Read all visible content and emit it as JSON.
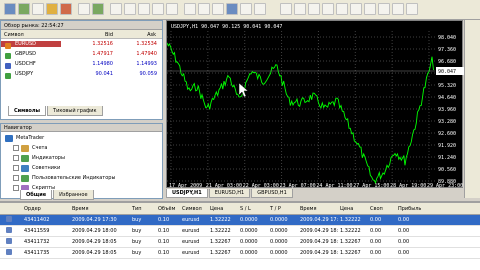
{
  "market_watch": {
    "title": "Обзор рынка: 22:54:27",
    "col_symbol": "Символ",
    "col_bid": "Bid",
    "col_ask": "Ask",
    "rows": [
      {
        "symbol": "EURUSD",
        "bid": "1.32516",
        "ask": "1.32534",
        "highlight": true
      },
      {
        "symbol": "GBPUSD",
        "bid": "1.47917",
        "ask": "1.47940",
        "highlight": false
      },
      {
        "symbol": "USDCHF",
        "bid": "1.14980",
        "ask": "1.14993",
        "highlight": false
      },
      {
        "symbol": "USDJPY",
        "bid": "90.041",
        "ask": "90.059",
        "highlight": false
      }
    ],
    "tabs": [
      "Символы",
      "Тиковый график"
    ]
  },
  "navigator": {
    "title": "Навигатор",
    "root": "MetaTrader",
    "items": [
      "Счета",
      "Индикаторы",
      "Советники",
      "Пользовательские Индикаторы",
      "Скрипты"
    ],
    "tabs": [
      "Общие",
      "Избранное"
    ]
  },
  "chart": {
    "header": "USDJPY,H1  90.047 90.125 90.041 90.047",
    "price_labels": [
      "98.040",
      "97.360",
      "96.680",
      "96.000",
      "95.320",
      "94.640",
      "93.960",
      "93.280",
      "92.600",
      "91.920",
      "91.240",
      "90.560",
      "89.880"
    ],
    "current_price": "90.047",
    "time_labels": [
      "17 Apr 2009",
      "21 Apr 03:00",
      "22 Apr 03:00",
      "23 Apr 07:00",
      "24 Apr 11:00",
      "27 Apr 15:00",
      "28 Apr 19:00",
      "29 Apr 23:00"
    ],
    "tabs": [
      "USDJPY,H1",
      "EURUSD,H1",
      "GBPUSD,H1"
    ],
    "colors": {
      "background": "#000000",
      "line": "#00ff00",
      "grid": "#404040"
    }
  },
  "terminal": {
    "headers": [
      "",
      "Ордер",
      "Время",
      "Тип",
      "Объём",
      "Символ",
      "Цена",
      "S / L",
      "T / P",
      "Время",
      "Цена",
      "Своп",
      "Прибыль"
    ],
    "rows": [
      {
        "order": "43411402",
        "time": "2009.04.29 17:30",
        "type": "buy",
        "volume": "0.10",
        "symbol": "eurusd",
        "price": "1.32222",
        "sl": "0.0000",
        "tp": "0.0000",
        "time2": "2009.04.29 17:39",
        "price2": "1.32222",
        "swap": "0.00",
        "profit": "0.00",
        "selected": true
      },
      {
        "order": "43411559",
        "time": "2009.04.29 18:00",
        "type": "buy",
        "volume": "0.10",
        "symbol": "eurusd",
        "price": "1.32222",
        "sl": "0.0000",
        "tp": "0.0000",
        "time2": "2009.04.29 18:00",
        "price2": "1.32222",
        "swap": "0.00",
        "profit": "0.00",
        "selected": false
      },
      {
        "order": "43411732",
        "time": "2009.04.29 18:05",
        "type": "buy",
        "volume": "0.10",
        "symbol": "eurusd",
        "price": "1.32267",
        "sl": "0.0000",
        "tp": "0.0000",
        "time2": "2009.04.29 18:05",
        "price2": "1.32267",
        "swap": "0.00",
        "profit": "0.00",
        "selected": false
      },
      {
        "order": "43411735",
        "time": "2009.04.29 18:05",
        "type": "buy",
        "volume": "0.10",
        "symbol": "eurusd",
        "price": "1.32267",
        "sl": "0.0000",
        "tp": "0.0000",
        "time2": "2009.04.29 18:05",
        "price2": "1.32267",
        "swap": "0.00",
        "profit": "0.00",
        "selected": false
      }
    ]
  }
}
